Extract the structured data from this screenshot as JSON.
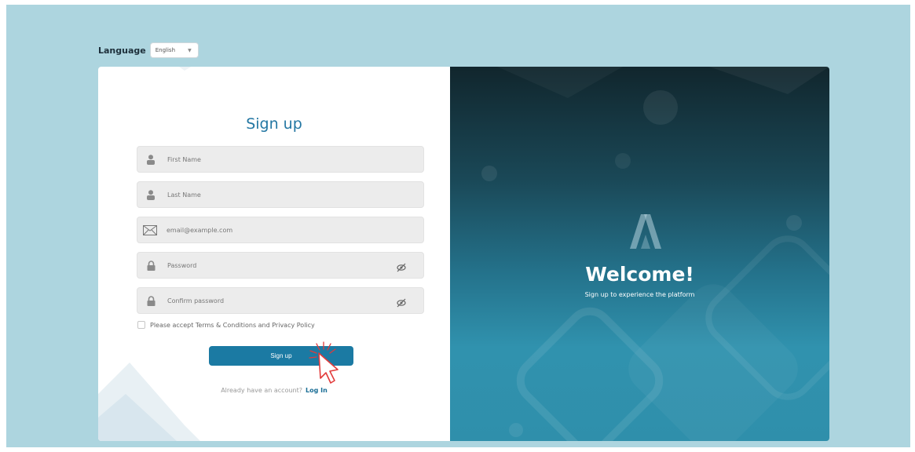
{
  "language": {
    "label": "Language",
    "selected": "English"
  },
  "form": {
    "title": "Sign up",
    "fields": [
      {
        "placeholder": "First Name",
        "icon": "user-icon"
      },
      {
        "placeholder": "Last Name",
        "icon": "user-icon"
      },
      {
        "placeholder": "email@example.com",
        "icon": "envelope-icon"
      },
      {
        "placeholder": "Password",
        "icon": "lock-icon",
        "toggle": "eye-slash-icon"
      },
      {
        "placeholder": "Confirm password",
        "icon": "lock-icon",
        "toggle": "eye-slash-icon"
      }
    ],
    "terms_label": "Please accept Terms & Conditions and Privacy Policy",
    "submit_label": "Sign up",
    "have_account_text": "Already have an account?",
    "login_link": "Log In"
  },
  "hero": {
    "title": "Welcome!",
    "subtitle": "Sign up to experience the platform",
    "logo_icon": "brand-logo-icon"
  },
  "colors": {
    "background": "#add5df",
    "accent": "#1b7aa3",
    "title": "#2477a3",
    "panel_dark": "#11262d",
    "panel_light": "#3092ae"
  }
}
